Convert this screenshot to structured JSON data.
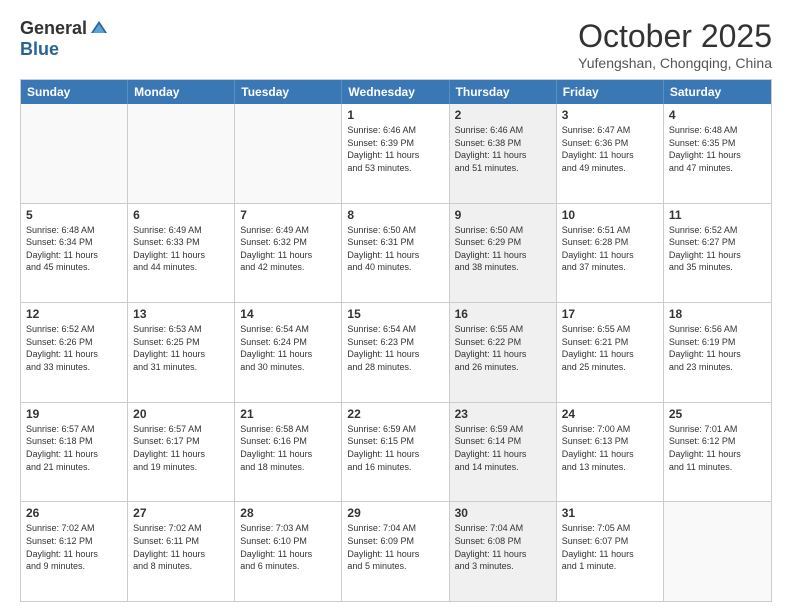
{
  "header": {
    "logo_general": "General",
    "logo_blue": "Blue",
    "month_title": "October 2025",
    "subtitle": "Yufengshan, Chongqing, China"
  },
  "weekdays": [
    "Sunday",
    "Monday",
    "Tuesday",
    "Wednesday",
    "Thursday",
    "Friday",
    "Saturday"
  ],
  "weeks": [
    [
      {
        "day": "",
        "info": "",
        "empty": true,
        "shaded": false
      },
      {
        "day": "",
        "info": "",
        "empty": true,
        "shaded": false
      },
      {
        "day": "",
        "info": "",
        "empty": true,
        "shaded": false
      },
      {
        "day": "1",
        "info": "Sunrise: 6:46 AM\nSunset: 6:39 PM\nDaylight: 11 hours\nand 53 minutes.",
        "empty": false,
        "shaded": false
      },
      {
        "day": "2",
        "info": "Sunrise: 6:46 AM\nSunset: 6:38 PM\nDaylight: 11 hours\nand 51 minutes.",
        "empty": false,
        "shaded": true
      },
      {
        "day": "3",
        "info": "Sunrise: 6:47 AM\nSunset: 6:36 PM\nDaylight: 11 hours\nand 49 minutes.",
        "empty": false,
        "shaded": false
      },
      {
        "day": "4",
        "info": "Sunrise: 6:48 AM\nSunset: 6:35 PM\nDaylight: 11 hours\nand 47 minutes.",
        "empty": false,
        "shaded": false
      }
    ],
    [
      {
        "day": "5",
        "info": "Sunrise: 6:48 AM\nSunset: 6:34 PM\nDaylight: 11 hours\nand 45 minutes.",
        "empty": false,
        "shaded": false
      },
      {
        "day": "6",
        "info": "Sunrise: 6:49 AM\nSunset: 6:33 PM\nDaylight: 11 hours\nand 44 minutes.",
        "empty": false,
        "shaded": false
      },
      {
        "day": "7",
        "info": "Sunrise: 6:49 AM\nSunset: 6:32 PM\nDaylight: 11 hours\nand 42 minutes.",
        "empty": false,
        "shaded": false
      },
      {
        "day": "8",
        "info": "Sunrise: 6:50 AM\nSunset: 6:31 PM\nDaylight: 11 hours\nand 40 minutes.",
        "empty": false,
        "shaded": false
      },
      {
        "day": "9",
        "info": "Sunrise: 6:50 AM\nSunset: 6:29 PM\nDaylight: 11 hours\nand 38 minutes.",
        "empty": false,
        "shaded": true
      },
      {
        "day": "10",
        "info": "Sunrise: 6:51 AM\nSunset: 6:28 PM\nDaylight: 11 hours\nand 37 minutes.",
        "empty": false,
        "shaded": false
      },
      {
        "day": "11",
        "info": "Sunrise: 6:52 AM\nSunset: 6:27 PM\nDaylight: 11 hours\nand 35 minutes.",
        "empty": false,
        "shaded": false
      }
    ],
    [
      {
        "day": "12",
        "info": "Sunrise: 6:52 AM\nSunset: 6:26 PM\nDaylight: 11 hours\nand 33 minutes.",
        "empty": false,
        "shaded": false
      },
      {
        "day": "13",
        "info": "Sunrise: 6:53 AM\nSunset: 6:25 PM\nDaylight: 11 hours\nand 31 minutes.",
        "empty": false,
        "shaded": false
      },
      {
        "day": "14",
        "info": "Sunrise: 6:54 AM\nSunset: 6:24 PM\nDaylight: 11 hours\nand 30 minutes.",
        "empty": false,
        "shaded": false
      },
      {
        "day": "15",
        "info": "Sunrise: 6:54 AM\nSunset: 6:23 PM\nDaylight: 11 hours\nand 28 minutes.",
        "empty": false,
        "shaded": false
      },
      {
        "day": "16",
        "info": "Sunrise: 6:55 AM\nSunset: 6:22 PM\nDaylight: 11 hours\nand 26 minutes.",
        "empty": false,
        "shaded": true
      },
      {
        "day": "17",
        "info": "Sunrise: 6:55 AM\nSunset: 6:21 PM\nDaylight: 11 hours\nand 25 minutes.",
        "empty": false,
        "shaded": false
      },
      {
        "day": "18",
        "info": "Sunrise: 6:56 AM\nSunset: 6:19 PM\nDaylight: 11 hours\nand 23 minutes.",
        "empty": false,
        "shaded": false
      }
    ],
    [
      {
        "day": "19",
        "info": "Sunrise: 6:57 AM\nSunset: 6:18 PM\nDaylight: 11 hours\nand 21 minutes.",
        "empty": false,
        "shaded": false
      },
      {
        "day": "20",
        "info": "Sunrise: 6:57 AM\nSunset: 6:17 PM\nDaylight: 11 hours\nand 19 minutes.",
        "empty": false,
        "shaded": false
      },
      {
        "day": "21",
        "info": "Sunrise: 6:58 AM\nSunset: 6:16 PM\nDaylight: 11 hours\nand 18 minutes.",
        "empty": false,
        "shaded": false
      },
      {
        "day": "22",
        "info": "Sunrise: 6:59 AM\nSunset: 6:15 PM\nDaylight: 11 hours\nand 16 minutes.",
        "empty": false,
        "shaded": false
      },
      {
        "day": "23",
        "info": "Sunrise: 6:59 AM\nSunset: 6:14 PM\nDaylight: 11 hours\nand 14 minutes.",
        "empty": false,
        "shaded": true
      },
      {
        "day": "24",
        "info": "Sunrise: 7:00 AM\nSunset: 6:13 PM\nDaylight: 11 hours\nand 13 minutes.",
        "empty": false,
        "shaded": false
      },
      {
        "day": "25",
        "info": "Sunrise: 7:01 AM\nSunset: 6:12 PM\nDaylight: 11 hours\nand 11 minutes.",
        "empty": false,
        "shaded": false
      }
    ],
    [
      {
        "day": "26",
        "info": "Sunrise: 7:02 AM\nSunset: 6:12 PM\nDaylight: 11 hours\nand 9 minutes.",
        "empty": false,
        "shaded": false
      },
      {
        "day": "27",
        "info": "Sunrise: 7:02 AM\nSunset: 6:11 PM\nDaylight: 11 hours\nand 8 minutes.",
        "empty": false,
        "shaded": false
      },
      {
        "day": "28",
        "info": "Sunrise: 7:03 AM\nSunset: 6:10 PM\nDaylight: 11 hours\nand 6 minutes.",
        "empty": false,
        "shaded": false
      },
      {
        "day": "29",
        "info": "Sunrise: 7:04 AM\nSunset: 6:09 PM\nDaylight: 11 hours\nand 5 minutes.",
        "empty": false,
        "shaded": false
      },
      {
        "day": "30",
        "info": "Sunrise: 7:04 AM\nSunset: 6:08 PM\nDaylight: 11 hours\nand 3 minutes.",
        "empty": false,
        "shaded": true
      },
      {
        "day": "31",
        "info": "Sunrise: 7:05 AM\nSunset: 6:07 PM\nDaylight: 11 hours\nand 1 minute.",
        "empty": false,
        "shaded": false
      },
      {
        "day": "",
        "info": "",
        "empty": true,
        "shaded": false
      }
    ]
  ]
}
